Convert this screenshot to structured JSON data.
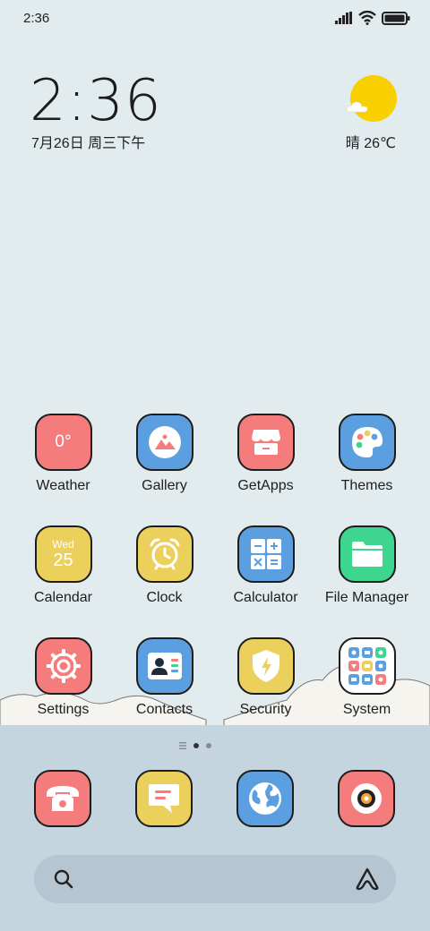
{
  "status_bar": {
    "time": "2:36",
    "icons": [
      "signal-icon",
      "wifi-icon",
      "battery-icon"
    ]
  },
  "clock_widget": {
    "time": "2:36",
    "date": "7月26日 周三下午"
  },
  "weather_widget": {
    "icon": "sunny-cloud-icon",
    "text": "晴 26℃"
  },
  "apps": [
    {
      "label": "Weather",
      "icon_text": "0°",
      "color": "#f47c7c"
    },
    {
      "label": "Gallery",
      "color": "#5b9fe0"
    },
    {
      "label": "GetApps",
      "color": "#f47c7c"
    },
    {
      "label": "Themes",
      "color": "#5b9fe0"
    },
    {
      "label": "Calendar",
      "icon_day": "Wed",
      "icon_date": "25",
      "color": "#ecd05c"
    },
    {
      "label": "Clock",
      "color": "#ecd05c"
    },
    {
      "label": "Calculator",
      "color": "#5b9fe0"
    },
    {
      "label": "File Manager",
      "color": "#3ed58e"
    },
    {
      "label": "Settings",
      "color": "#f47c7c"
    },
    {
      "label": "Contacts",
      "color": "#5b9fe0"
    },
    {
      "label": "Security",
      "color": "#ecd05c"
    },
    {
      "label": "System",
      "color": "#ffffff"
    }
  ],
  "page_indicator": {
    "pages": 2,
    "active": 1
  },
  "dock": [
    {
      "name": "phone",
      "color": "#f47c7c"
    },
    {
      "name": "messaging",
      "color": "#ecd05c"
    },
    {
      "name": "browser",
      "color": "#5b9fe0"
    },
    {
      "name": "camera",
      "color": "#f47c7c"
    }
  ],
  "search_bar": {
    "icons": [
      "search-icon",
      "assistant-icon"
    ]
  }
}
